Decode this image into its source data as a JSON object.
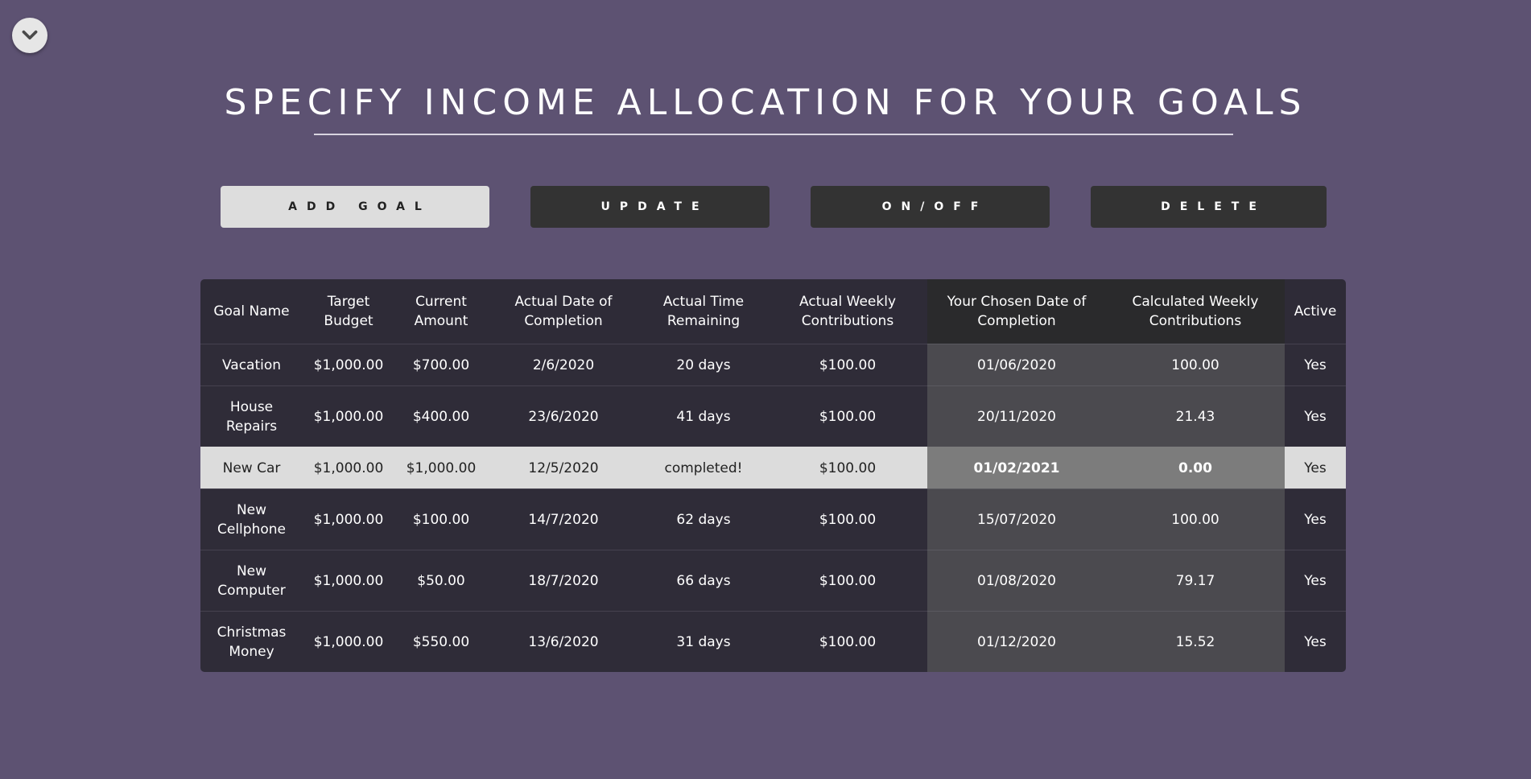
{
  "page": {
    "title": "SPECIFY INCOME ALLOCATION FOR YOUR GOALS",
    "collapse_icon": "chevron-down-icon"
  },
  "toolbar": {
    "add_label": "ADD GOAL",
    "update_label": "UPDATE",
    "onoff_label": "ON/OFF",
    "delete_label": "DELETE"
  },
  "table": {
    "headers": [
      "Goal Name",
      "Target Budget",
      "Current Amount",
      "Actual Date of Completion",
      "Actual Time Remaining",
      "Actual Weekly Contributions",
      "Your Chosen Date of Completion",
      "Calculated Weekly Contributions",
      "Active"
    ],
    "rows": [
      {
        "name": "Vacation",
        "target": "$1,000.00",
        "current": "$700.00",
        "actual_date": "2/6/2020",
        "remaining": "20 days",
        "actual_weekly": "$100.00",
        "chosen_date": "01/06/2020",
        "calc_weekly": "100.00",
        "active": "Yes"
      },
      {
        "name": "House Repairs",
        "target": "$1,000.00",
        "current": "$400.00",
        "actual_date": "23/6/2020",
        "remaining": "41 days",
        "actual_weekly": "$100.00",
        "chosen_date": "20/11/2020",
        "calc_weekly": "21.43",
        "active": "Yes"
      },
      {
        "name": "New Car",
        "target": "$1,000.00",
        "current": "$1,000.00",
        "actual_date": "12/5/2020",
        "remaining": "completed!",
        "actual_weekly": "$100.00",
        "chosen_date": "01/02/2021",
        "calc_weekly": "0.00",
        "active": "Yes"
      },
      {
        "name": "New Cellphone",
        "target": "$1,000.00",
        "current": "$100.00",
        "actual_date": "14/7/2020",
        "remaining": "62 days",
        "actual_weekly": "$100.00",
        "chosen_date": "15/07/2020",
        "calc_weekly": "100.00",
        "active": "Yes"
      },
      {
        "name": "New Computer",
        "target": "$1,000.00",
        "current": "$50.00",
        "actual_date": "18/7/2020",
        "remaining": "66 days",
        "actual_weekly": "$100.00",
        "chosen_date": "01/08/2020",
        "calc_weekly": "79.17",
        "active": "Yes"
      },
      {
        "name": "Christmas Money",
        "target": "$1,000.00",
        "current": "$550.00",
        "actual_date": "13/6/2020",
        "remaining": "31 days",
        "actual_weekly": "$100.00",
        "chosen_date": "01/12/2020",
        "calc_weekly": "15.52",
        "active": "Yes"
      }
    ],
    "selected_row": "New Car"
  },
  "colors": {
    "background": "#5d5272",
    "table_dark": "#2f2c38",
    "chosen_column": "#4b4a4f",
    "selected_row": "#dcdcdc"
  }
}
